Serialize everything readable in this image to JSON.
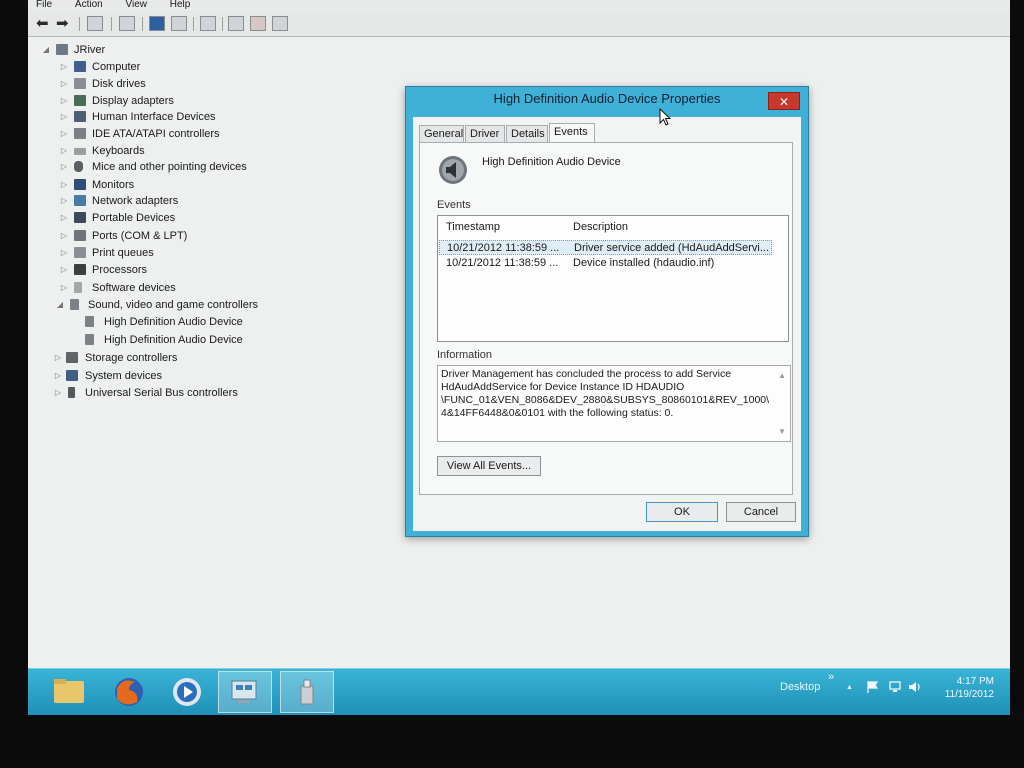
{
  "menubar": {
    "items": [
      "File",
      "Action",
      "View",
      "Help"
    ]
  },
  "tree": {
    "root": "JRiver",
    "categories": [
      "Computer",
      "Disk drives",
      "Display adapters",
      "Human Interface Devices",
      "IDE ATA/ATAPI controllers",
      "Keyboards",
      "Mice and other pointing devices",
      "Monitors",
      "Network adapters",
      "Portable Devices",
      "Ports (COM & LPT)",
      "Print queues",
      "Processors",
      "Software devices",
      "Sound, video and game controllers",
      "High Definition Audio Device",
      "High Definition Audio Device",
      "Storage controllers",
      "System devices",
      "Universal Serial Bus controllers"
    ]
  },
  "dialog": {
    "title": "High Definition Audio Device Properties",
    "close": "✕",
    "tabs": [
      "General",
      "Driver",
      "Details",
      "Events"
    ],
    "active_tab": "Events",
    "device_name": "High Definition Audio Device",
    "events_label": "Events",
    "columns": [
      "Timestamp",
      "Description"
    ],
    "events": [
      {
        "timestamp": "10/21/2012 11:38:59 ...",
        "description": "Driver service added (HdAudAddServi..."
      },
      {
        "timestamp": "10/21/2012 11:38:59 ...",
        "description": "Device installed (hdaudio.inf)"
      }
    ],
    "info_label": "Information",
    "info_lines": [
      "Driver Management has concluded the process to add Service",
      "HdAudAddService for Device Instance ID HDAUDIO",
      "\\FUNC_01&VEN_8086&DEV_2880&SUBSYS_80860101&REV_1000\\",
      "4&14FF6448&0&0101 with the following status: 0."
    ],
    "view_all": "View All Events...",
    "ok": "OK",
    "cancel": "Cancel"
  },
  "taskbar": {
    "desktop_label": "Desktop",
    "overflow": "»",
    "tray_chevron": "▲",
    "time": "4:17 PM",
    "date": "11/19/2012"
  },
  "colors": {
    "dialog_frame": "#3fb0d6",
    "taskbar": "#2aa3c8",
    "close_button": "#c7392d"
  }
}
